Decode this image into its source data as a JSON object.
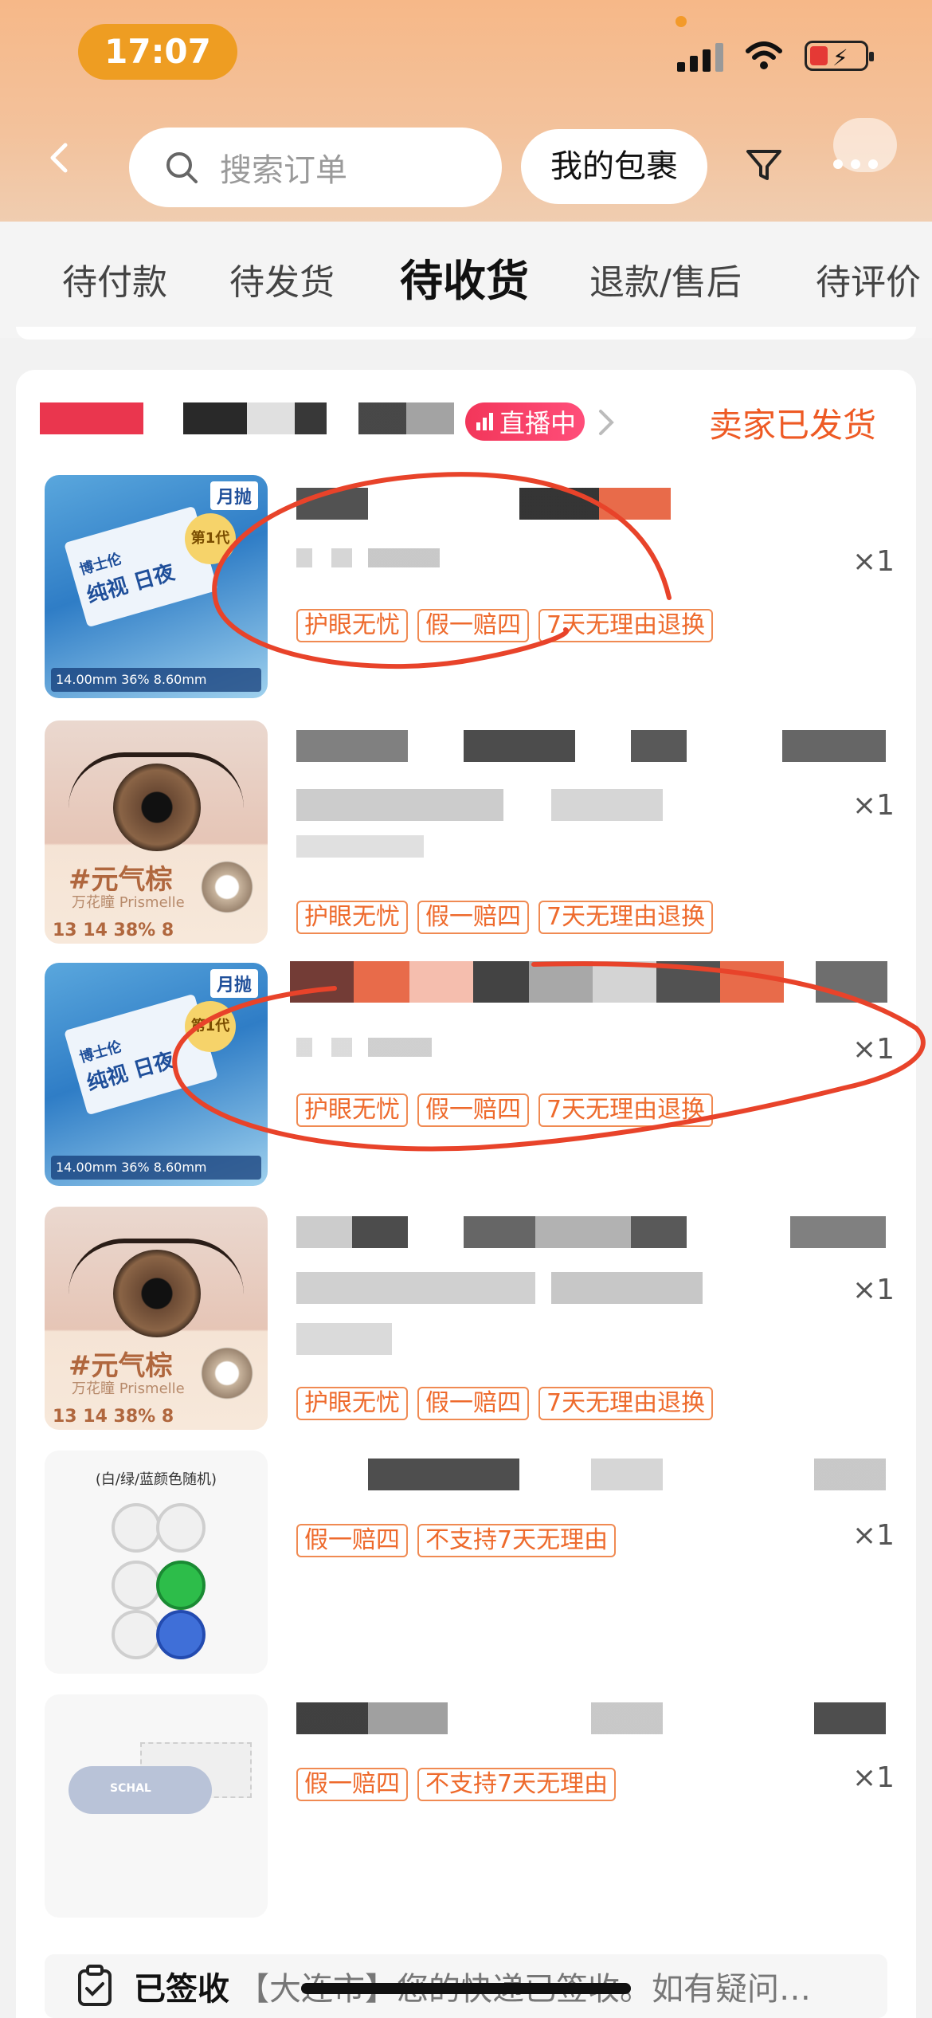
{
  "status_bar": {
    "time": "17:07"
  },
  "header": {
    "search_placeholder": "搜索订单",
    "my_parcel": "我的包裹"
  },
  "tabs": [
    "待付款",
    "待发货",
    "待收货",
    "退款/售后",
    "待评价"
  ],
  "order": {
    "live_label": "直播中",
    "status": "卖家已发货",
    "items": [
      {
        "thumb": {
          "monthly": "月抛",
          "brand": "博士伦",
          "name": "纯视 日夜",
          "gen": "第1代",
          "spec": "14.00mm   36%   8.60mm"
        },
        "tags": [
          "护眼无忧",
          "假一赔四",
          "7天无理由退换"
        ],
        "qty": "×1"
      },
      {
        "thumb": {
          "color_name": "#元气棕",
          "color_sub": "万花瞳 Prismelle",
          "spec": "13 14 38% 8"
        },
        "tags": [
          "护眼无忧",
          "假一赔四",
          "7天无理由退换"
        ],
        "qty": "×1"
      },
      {
        "thumb": {
          "monthly": "月抛",
          "brand": "博士伦",
          "name": "纯视 日夜",
          "gen": "第1代",
          "spec": "14.00mm   36%   8.60mm"
        },
        "tags": [
          "护眼无忧",
          "假一赔四",
          "7天无理由退换"
        ],
        "qty": "×1"
      },
      {
        "thumb": {
          "color_name": "#元气棕",
          "color_sub": "万花瞳 Prismelle",
          "spec": "13 14 38% 8"
        },
        "tags": [
          "护眼无忧",
          "假一赔四",
          "7天无理由退换"
        ],
        "qty": "×1"
      },
      {
        "thumb": {
          "caption": "(白/绿/蓝颜色随机)"
        },
        "tags": [
          "假一赔四",
          "不支持7天无理由"
        ],
        "qty": "×1"
      },
      {
        "thumb": {
          "label": "SCHAL"
        },
        "tags": [
          "假一赔四",
          "不支持7天无理由"
        ],
        "qty": "×1"
      }
    ]
  },
  "signed": {
    "label": "已签收",
    "message": "【大连市】您的快递已签收。如有疑问…"
  },
  "colors": {
    "accent": "#ee5a24",
    "tag_border": "#f08a52",
    "live": "#f2365a",
    "annotation": "#e8432a"
  }
}
